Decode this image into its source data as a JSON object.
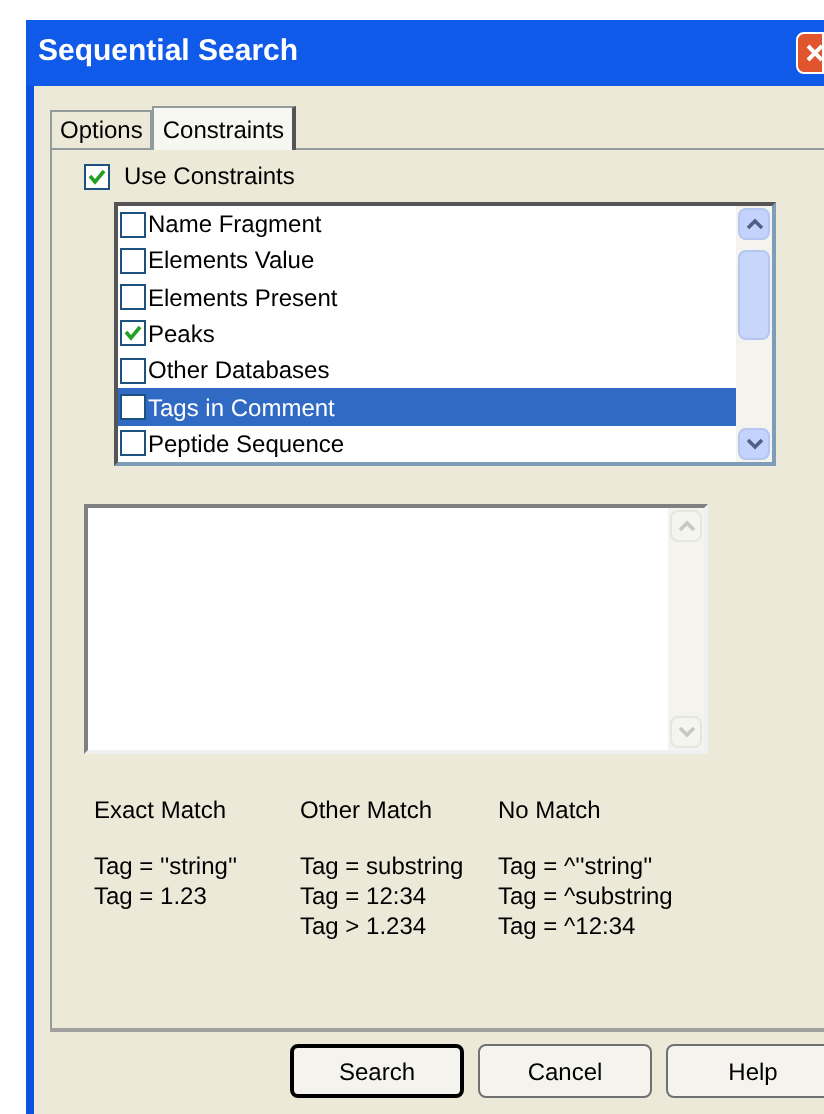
{
  "window": {
    "title": "Sequential Search"
  },
  "tabs": [
    {
      "label": "Options",
      "selected": false
    },
    {
      "label": "Constraints",
      "selected": true
    }
  ],
  "use_constraints": {
    "label": "Use Constraints",
    "checked": true
  },
  "constraints": [
    {
      "label": "Name Fragment",
      "checked": false,
      "selected": false
    },
    {
      "label": "Elements Value",
      "checked": false,
      "selected": false
    },
    {
      "label": "Elements Present",
      "checked": false,
      "selected": false
    },
    {
      "label": "Peaks",
      "checked": true,
      "selected": false
    },
    {
      "label": "Other Databases",
      "checked": false,
      "selected": false
    },
    {
      "label": "Tags in Comment",
      "checked": false,
      "selected": true
    },
    {
      "label": "Peptide Sequence",
      "checked": false,
      "selected": false
    }
  ],
  "help_columns": [
    {
      "heading": "Exact Match",
      "lines": [
        "Tag = ''string''",
        "Tag = 1.23"
      ]
    },
    {
      "heading": "Other Match",
      "lines": [
        "Tag = substring",
        "Tag = 12:34",
        "Tag > 1.234"
      ]
    },
    {
      "heading": "No Match",
      "lines": [
        "Tag = ^''string''",
        "Tag = ^substring",
        "Tag = ^12:34"
      ]
    }
  ],
  "buttons": [
    {
      "label": "Search",
      "default": true
    },
    {
      "label": "Cancel",
      "default": false
    },
    {
      "label": "Help",
      "default": false
    }
  ]
}
